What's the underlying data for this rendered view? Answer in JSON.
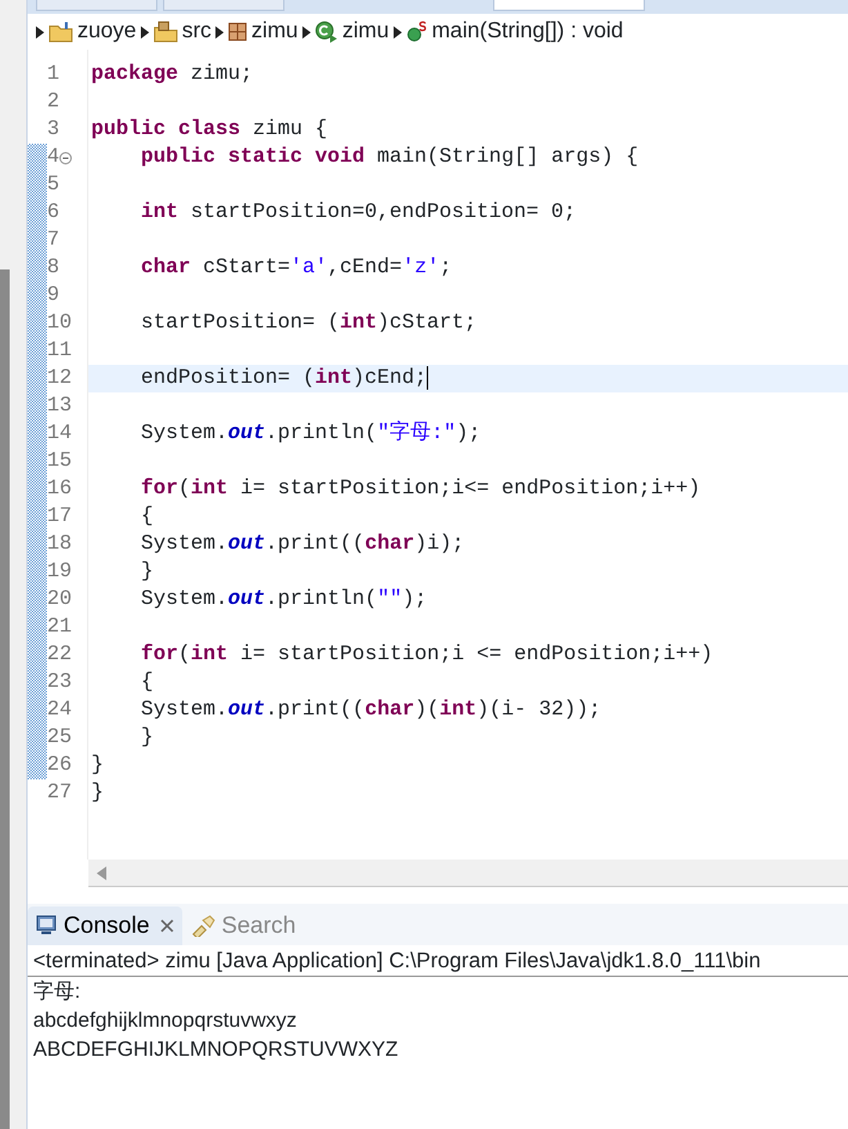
{
  "editor_tabs": [
    {
      "selected": false
    },
    {
      "selected": false
    },
    {
      "selected": true
    }
  ],
  "breadcrumb": [
    {
      "kind": "project",
      "label": "zuoye"
    },
    {
      "kind": "folder",
      "label": "src"
    },
    {
      "kind": "package",
      "label": "zimu"
    },
    {
      "kind": "class",
      "label": "zimu"
    },
    {
      "kind": "method",
      "label": "main(String[]) : void"
    }
  ],
  "editor": {
    "lines": [
      {
        "number": "1",
        "changed": false,
        "current": false,
        "fold": false,
        "tokens": [
          {
            "kind": "keyword",
            "text": "package"
          },
          {
            "kind": "plain",
            "text": " zimu;"
          }
        ]
      },
      {
        "number": "2",
        "changed": false,
        "current": false,
        "fold": false
      },
      {
        "number": "3",
        "changed": false,
        "current": false,
        "fold": false,
        "tokens": [
          {
            "kind": "keyword",
            "text": "public"
          },
          {
            "kind": "keyword",
            "text": " class"
          },
          {
            "kind": "plain",
            "text": " zimu {"
          }
        ]
      },
      {
        "number": "4",
        "changed": true,
        "current": false,
        "fold": true,
        "tokens": [
          {
            "kind": "keyword",
            "text": "    public"
          },
          {
            "kind": "keyword",
            "text": " static"
          },
          {
            "kind": "keyword",
            "text": " void"
          },
          {
            "kind": "plain",
            "text": " main(String[] args) {"
          }
        ]
      },
      {
        "number": "5",
        "changed": true,
        "current": false,
        "fold": false
      },
      {
        "number": "6",
        "changed": true,
        "current": false,
        "fold": false,
        "tokens": [
          {
            "kind": "keyword",
            "text": "    int"
          },
          {
            "kind": "plain",
            "text": " startPosition=0,endPosition= 0;"
          }
        ]
      },
      {
        "number": "7",
        "changed": true,
        "current": false,
        "fold": false
      },
      {
        "number": "8",
        "changed": true,
        "current": false,
        "fold": false,
        "tokens": [
          {
            "kind": "keyword",
            "text": "    char"
          },
          {
            "kind": "plain",
            "text": " cStart="
          },
          {
            "kind": "string",
            "text": "'a'"
          },
          {
            "kind": "plain",
            "text": ",cEnd="
          },
          {
            "kind": "string",
            "text": "'z'"
          },
          {
            "kind": "plain",
            "text": ";"
          }
        ]
      },
      {
        "number": "9",
        "changed": true,
        "current": false,
        "fold": false
      },
      {
        "number": "10",
        "changed": true,
        "current": false,
        "fold": false,
        "tokens": [
          {
            "kind": "plain",
            "text": "    startPosition= ("
          },
          {
            "kind": "keyword",
            "text": "int"
          },
          {
            "kind": "plain",
            "text": ")cStart;"
          }
        ]
      },
      {
        "number": "11",
        "changed": true,
        "current": false,
        "fold": false
      },
      {
        "number": "12",
        "changed": true,
        "current": true,
        "fold": false,
        "tokens": [
          {
            "kind": "plain",
            "text": "    endPosition= ("
          },
          {
            "kind": "keyword",
            "text": "int"
          },
          {
            "kind": "plain",
            "text": ")cEnd;"
          }
        ]
      },
      {
        "number": "13",
        "changed": true,
        "current": false,
        "fold": false
      },
      {
        "number": "14",
        "changed": true,
        "current": false,
        "fold": false,
        "tokens": [
          {
            "kind": "plain",
            "text": "    System."
          },
          {
            "kind": "field",
            "text": "out"
          },
          {
            "kind": "plain",
            "text": ".println("
          },
          {
            "kind": "string",
            "text": "\"字母:\""
          },
          {
            "kind": "plain",
            "text": ");"
          }
        ]
      },
      {
        "number": "15",
        "changed": true,
        "current": false,
        "fold": false
      },
      {
        "number": "16",
        "changed": true,
        "current": false,
        "fold": false,
        "tokens": [
          {
            "kind": "keyword",
            "text": "    for"
          },
          {
            "kind": "plain",
            "text": "("
          },
          {
            "kind": "keyword",
            "text": "int"
          },
          {
            "kind": "plain",
            "text": " i= startPosition;i<= endPosition;i++)"
          }
        ]
      },
      {
        "number": "17",
        "changed": true,
        "current": false,
        "fold": false,
        "tokens": [
          {
            "kind": "plain",
            "text": "    {"
          }
        ]
      },
      {
        "number": "18",
        "changed": true,
        "current": false,
        "fold": false,
        "tokens": [
          {
            "kind": "plain",
            "text": "    System."
          },
          {
            "kind": "field",
            "text": "out"
          },
          {
            "kind": "plain",
            "text": ".print(("
          },
          {
            "kind": "keyword",
            "text": "char"
          },
          {
            "kind": "plain",
            "text": ")i);"
          }
        ]
      },
      {
        "number": "19",
        "changed": true,
        "current": false,
        "fold": false,
        "tokens": [
          {
            "kind": "plain",
            "text": "    }"
          }
        ]
      },
      {
        "number": "20",
        "changed": true,
        "current": false,
        "fold": false,
        "tokens": [
          {
            "kind": "plain",
            "text": "    System."
          },
          {
            "kind": "field",
            "text": "out"
          },
          {
            "kind": "plain",
            "text": ".println("
          },
          {
            "kind": "string",
            "text": "\"\""
          },
          {
            "kind": "plain",
            "text": ");"
          }
        ]
      },
      {
        "number": "21",
        "changed": true,
        "current": false,
        "fold": false
      },
      {
        "number": "22",
        "changed": true,
        "current": false,
        "fold": false,
        "tokens": [
          {
            "kind": "keyword",
            "text": "    for"
          },
          {
            "kind": "plain",
            "text": "("
          },
          {
            "kind": "keyword",
            "text": "int"
          },
          {
            "kind": "plain",
            "text": " i= startPosition;i <= endPosition;i++)"
          }
        ]
      },
      {
        "number": "23",
        "changed": true,
        "current": false,
        "fold": false,
        "tokens": [
          {
            "kind": "plain",
            "text": "    {"
          }
        ]
      },
      {
        "number": "24",
        "changed": true,
        "current": false,
        "fold": false,
        "tokens": [
          {
            "kind": "plain",
            "text": "    System."
          },
          {
            "kind": "field",
            "text": "out"
          },
          {
            "kind": "plain",
            "text": ".print(("
          },
          {
            "kind": "keyword",
            "text": "char"
          },
          {
            "kind": "plain",
            "text": ")("
          },
          {
            "kind": "keyword",
            "text": "int"
          },
          {
            "kind": "plain",
            "text": ")(i- 32));"
          }
        ]
      },
      {
        "number": "25",
        "changed": true,
        "current": false,
        "fold": false,
        "tokens": [
          {
            "kind": "plain",
            "text": "    }"
          }
        ]
      },
      {
        "number": "26",
        "changed": true,
        "current": false,
        "fold": false,
        "tokens": [
          {
            "kind": "plain",
            "text": "}"
          }
        ]
      },
      {
        "number": "27",
        "changed": false,
        "current": false,
        "fold": false,
        "tokens": [
          {
            "kind": "plain",
            "text": "}"
          }
        ]
      }
    ]
  },
  "views": {
    "tabs": [
      {
        "kind": "console",
        "label": "Console",
        "selected": true,
        "closable": true
      },
      {
        "kind": "search",
        "label": "Search",
        "selected": false,
        "closable": false
      }
    ]
  },
  "console": {
    "header": "<terminated> zimu [Java Application] C:\\Program Files\\Java\\jdk1.8.0_111\\bin",
    "output": [
      "字母:",
      "abcdefghijklmnopqrstuvwxyz",
      "ABCDEFGHIJKLMNOPQRSTUVWXYZ"
    ]
  }
}
